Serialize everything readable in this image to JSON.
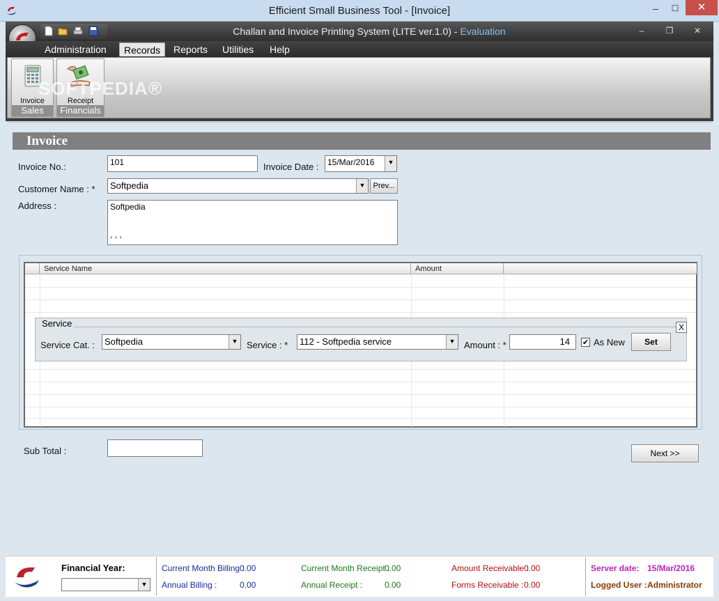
{
  "outer_window": {
    "title": "Efficient Small Business Tool - [Invoice]",
    "min": "–",
    "max": "☐",
    "close": "✕"
  },
  "app": {
    "title": "Challan and Invoice Printing System (LITE ver.1.0) - ",
    "edition": "Evaluation",
    "inner_min": "–",
    "inner_restore": "❐",
    "inner_close": "✕"
  },
  "menu": [
    "Administration",
    "Records",
    "Reports",
    "Utilities",
    "Help"
  ],
  "ribbon": {
    "groups": [
      {
        "label": "Sales",
        "button": "Invoice",
        "icon": "calculator-icon"
      },
      {
        "label": "Financials",
        "button": "Receipt",
        "icon": "money-hand-icon"
      }
    ],
    "watermark": "SOFTPEDIA®"
  },
  "invoice": {
    "header": "Invoice",
    "invoice_no_label": "Invoice No.:",
    "invoice_no": "101",
    "invoice_date_label": "Invoice Date :",
    "invoice_date": "15/Mar/2016",
    "customer_label": "Customer Name : *",
    "customer": "Softpedia",
    "prev_button": "Prev...",
    "address_label": "Address :",
    "address_line1": "Softpedia",
    "address_line2": ", , ,"
  },
  "grid": {
    "columns": [
      "Service Name",
      "Amount",
      ""
    ]
  },
  "service": {
    "legend": "Service",
    "close": "X",
    "cat_label": "Service Cat. :",
    "cat_value": "Softpedia",
    "service_label": "Service : *",
    "service_value": "112 - Softpedia service",
    "amount_label": "Amount : *",
    "amount_value": "14",
    "as_new_label": "As New",
    "as_new_checked": "✔",
    "set_button": "Set"
  },
  "footer": {
    "subtotal_label": "Sub Total :",
    "subtotal_value": "",
    "next_button": "Next >>"
  },
  "status": {
    "financial_year_label": "Financial Year:",
    "financial_year_value": "",
    "current_month_billing_label": "Current Month Billing :",
    "current_month_billing": "0.00",
    "annual_billing_label": "Annual Billing :",
    "annual_billing": "0.00",
    "current_month_receipt_label": "Current Month Receipt :",
    "current_month_receipt": "0.00",
    "annual_receipt_label": "Annual Receipt :",
    "annual_receipt": "0.00",
    "amount_receivable_label": "Amount Receivable :",
    "amount_receivable": "0.00",
    "forms_receivable_label": "Forms Receivable :",
    "forms_receivable": "0.00",
    "server_date_label": "Server date:",
    "server_date": "15/Mar/2016",
    "logged_user_label": "Logged User :",
    "logged_user": "Administrator"
  },
  "colors": {
    "eval_blue": "#7ec3f5",
    "close_red": "#c7504a",
    "header_gray": "#808080"
  }
}
